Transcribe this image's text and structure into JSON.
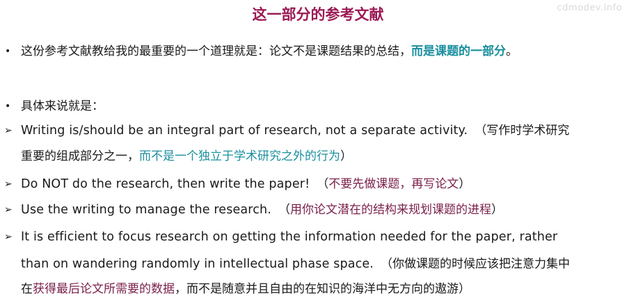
{
  "watermark": "cdmodev.info",
  "title": "这一部分的参考文献",
  "bullet1": {
    "plain": "这份参考文献教给我的最重要的一个道理就是：论文不是课题结果的总结，",
    "highlight": "而是课题的一部分",
    "end": "。"
  },
  "bullet2": {
    "plain": "具体来说就是："
  },
  "points": [
    {
      "en": "Writing is/should be an integral part of research, not a separate activity.",
      "cn_open": "（写作时学术研究",
      "cn_line2_plain": "重要的组成部分之一，",
      "cn_line2_highlight": "而不是一个独立于学术研究之外的行为",
      "cn_line2_close": "）"
    },
    {
      "en": "Do NOT do the research, then write the paper!",
      "cn_open": "（",
      "cn_highlight": "不要先做课题，再写论文",
      "cn_close": "）"
    },
    {
      "en": "Use the writing to manage the research.",
      "cn_open": "（",
      "cn_highlight": "用你论文潜在的结构来规划课题的进程",
      "cn_close": "）"
    },
    {
      "en_line1": "It is efficient to focus research on getting the information needed for the paper, rather",
      "en_line2": "than on wandering randomly in intellectual phase space.",
      "cn_line2": "（你做课题的时候应该把注意力集中",
      "cn_line3_start": "在",
      "cn_line3_highlight": "获得最后论文所需要的数据",
      "cn_line3_rest": "，而不是随意并且自由的在知识的海洋中无方向的遨游）"
    }
  ],
  "bullet_dot_glyph": "•",
  "bullet_arrow_glyph": "➢",
  "colors": {
    "title": "#9b1a55",
    "teal": "#1a8f9e",
    "maroon": "#7a1f4a",
    "text": "#1a1a1a"
  }
}
